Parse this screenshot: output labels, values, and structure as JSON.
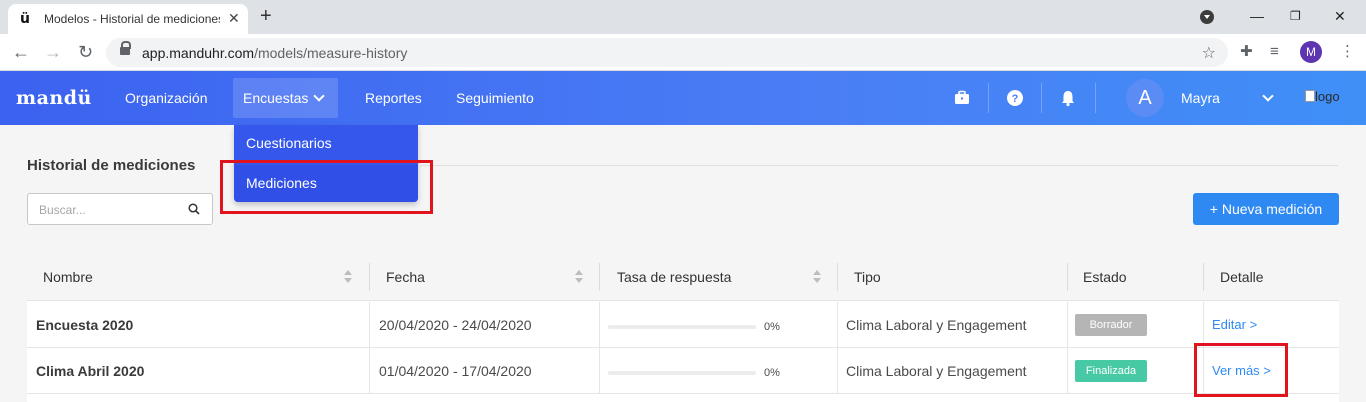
{
  "browser": {
    "tab_title": "Modelos - Historial de mediciones",
    "favicon_text": "ü",
    "url_host": "app.manduhr.com",
    "url_path": "/models/measure-history",
    "profile_initial": "M"
  },
  "navbar": {
    "brand": "mandü",
    "items": [
      {
        "label": "Organización"
      },
      {
        "label": "Encuestas"
      },
      {
        "label": "Reportes"
      },
      {
        "label": "Seguimiento"
      }
    ],
    "user_initial": "A",
    "user_name": "Mayra",
    "logo_alt": "logo"
  },
  "dropdown": {
    "items": [
      {
        "label": "Cuestionarios"
      },
      {
        "label": "Mediciones"
      }
    ]
  },
  "page": {
    "title": "Historial de mediciones",
    "search_placeholder": "Buscar...",
    "new_button": "+ Nueva medición"
  },
  "table": {
    "headers": [
      "Nombre",
      "Fecha",
      "Tasa de respuesta",
      "Tipo",
      "Estado",
      "Detalle"
    ],
    "rows": [
      {
        "name": "Encuesta 2020",
        "date": "20/04/2020 - 24/04/2020",
        "response_rate": 0,
        "response_rate_label": "0%",
        "type": "Clima Laboral y Engagement",
        "status": "Borrador",
        "status_color": "#b5b5b5",
        "action": "Editar >"
      },
      {
        "name": "Clima Abril 2020",
        "date": "01/04/2020 - 17/04/2020",
        "response_rate": 0,
        "response_rate_label": "0%",
        "type": "Clima Laboral y Engagement",
        "status": "Finalizada",
        "status_color": "#48c9a5",
        "action": "Ver más >"
      }
    ]
  },
  "colors": {
    "accent": "#2e89f3",
    "highlight": "#e0141e"
  }
}
